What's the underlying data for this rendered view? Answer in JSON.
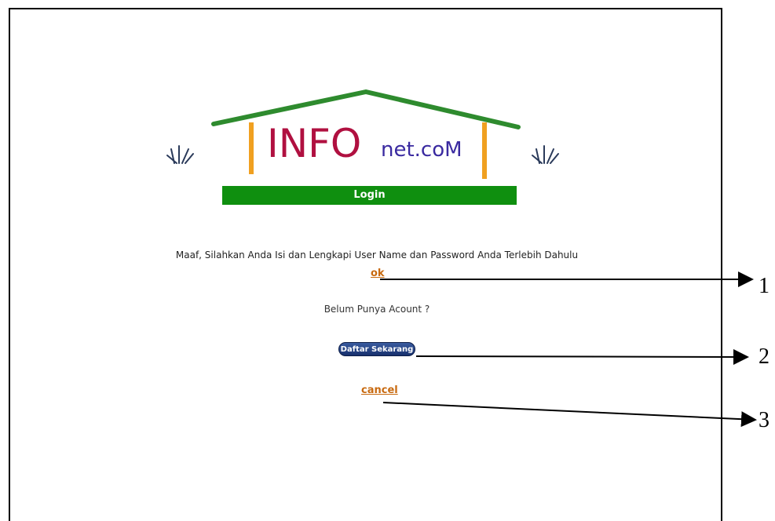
{
  "logo": {
    "brand_main": "INFO",
    "brand_suffix": "net.coM",
    "colors": {
      "roof": "#2e8b2e",
      "posts": "#f0a020",
      "brand_main": "#b01040",
      "brand_suffix": "#3a2aa0"
    },
    "decoration_icon": "grass-tuft-icon"
  },
  "login_bar": {
    "label": "Login",
    "color": "#0f8f0f"
  },
  "message": "Maaf, Silahkan Anda Isi dan Lengkapi User Name dan Password Anda Terlebih Dahulu",
  "ok_link": "ok",
  "question": "Belum Punya Acount ?",
  "register_button": "Daftar Sekarang",
  "cancel_link": "cancel",
  "callouts": [
    "1",
    "2",
    "3"
  ],
  "link_color": "#c86a10"
}
